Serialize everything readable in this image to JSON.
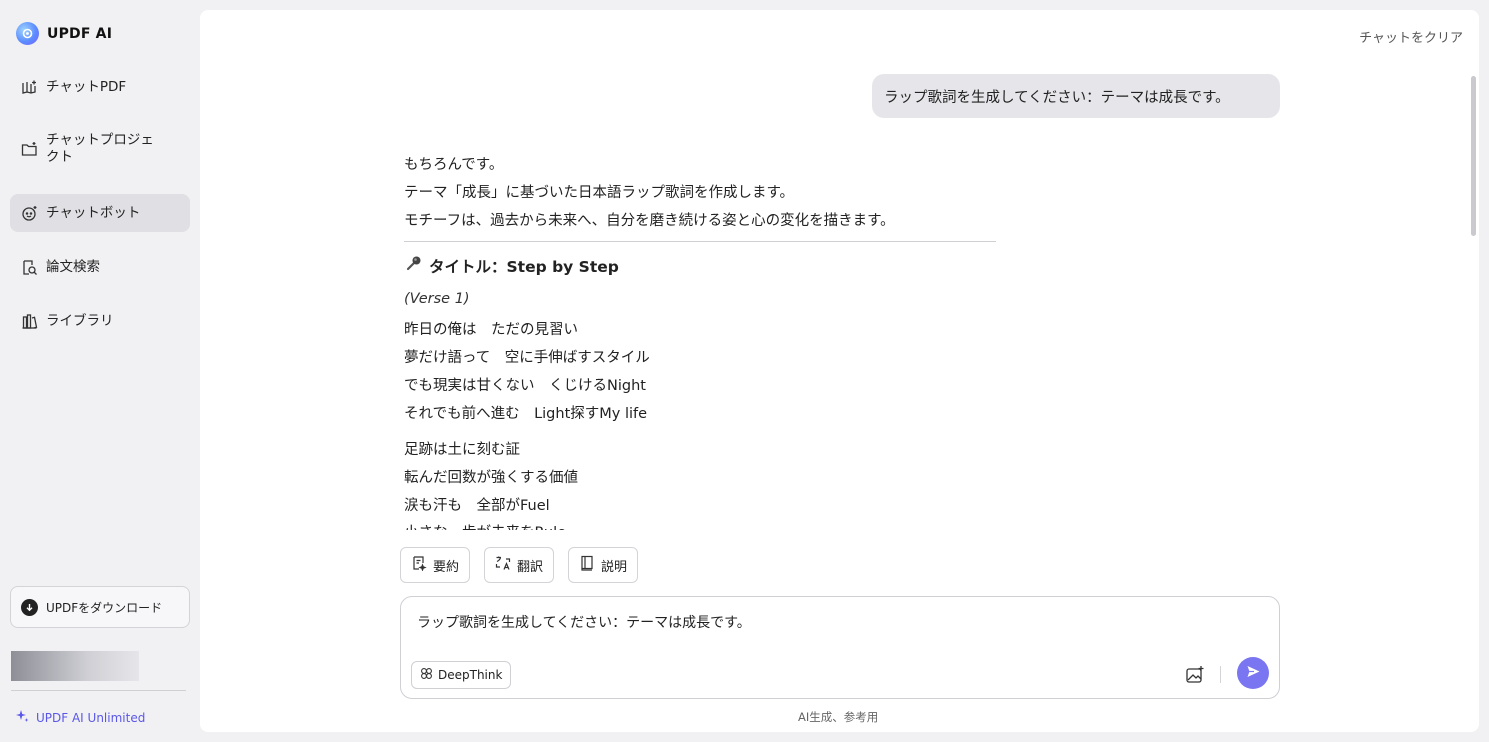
{
  "brand": {
    "name": "UPDF AI"
  },
  "sidebar": {
    "items": [
      {
        "label": "チャットPDF",
        "icon": "chat-pdf-icon",
        "active": false
      },
      {
        "label": "チャットプロジェクト",
        "icon": "folder-plus-icon",
        "active": false
      },
      {
        "label": "チャットボット",
        "icon": "chatbot-icon",
        "active": true
      },
      {
        "label": "論文検索",
        "icon": "paper-search-icon",
        "active": false
      },
      {
        "label": "ライブラリ",
        "icon": "library-icon",
        "active": false
      }
    ],
    "download_label": "UPDFをダウンロード",
    "unlimited_label": "UPDF AI Unlimited"
  },
  "header": {
    "clear_chat": "チャットをクリア"
  },
  "chat": {
    "user_message": "ラップ歌詞を生成してください：テーマは成長です。",
    "answer": {
      "intro_1": "もちろんです。",
      "intro_2": "テーマ「成長」に基づいた日本語ラップ歌詞を作成します。",
      "intro_3": "モチーフは、過去から未来へ、自分を磨き続ける姿と心の変化を描きます。",
      "title": "タイトル：Step by Step",
      "verse_label": "(Verse 1)",
      "lines_a": [
        "昨日の俺は　ただの見習い",
        "夢だけ語って　空に手伸ばすスタイル",
        "でも現実は甘くない　くじけるNight",
        "それでも前へ進む　Light探すMy life"
      ],
      "lines_b": [
        "足跡は土に刻む証",
        "転んだ回数が強くする価値",
        "涙も汗も　全部がFuel",
        "小さな一歩が未来をRule"
      ]
    }
  },
  "actions": {
    "summarize": "要約",
    "translate": "翻訳",
    "explain": "説明"
  },
  "input": {
    "value": "ラップ歌詞を生成してください：テーマは成長です。",
    "deepthink": "DeepThink"
  },
  "footer": {
    "note": "AI生成、参考用"
  },
  "colors": {
    "accent": "#7a75f0",
    "unlimited": "#5a57e8",
    "active_nav": "#e0e0e4"
  }
}
